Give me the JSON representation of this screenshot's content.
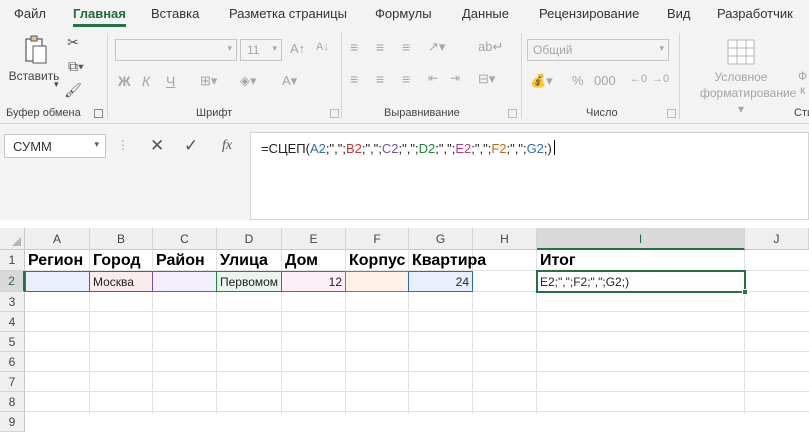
{
  "tabs": [
    "Файл",
    "Главная",
    "Вставка",
    "Разметка страницы",
    "Формулы",
    "Данные",
    "Рецензирование",
    "Вид",
    "Разработчик"
  ],
  "active_tab": "Главная",
  "ribbon": {
    "clipboard": {
      "paste": "Вставить",
      "label": "Буфер обмена"
    },
    "font": {
      "name": "",
      "size": "11",
      "bold": "Ж",
      "italic": "К",
      "underline": "Ч",
      "label": "Шрифт"
    },
    "alignment": {
      "label": "Выравнивание"
    },
    "number": {
      "format": "Общий",
      "label": "Число"
    },
    "styles": {
      "conditional_line1": "Условное",
      "conditional_line2": "форматирование",
      "label": "Сти"
    }
  },
  "formula_bar": {
    "name_box": "СУММ",
    "fx": "fx",
    "formula_parts": [
      "=СЦЕП(",
      "A2",
      ";\",\";",
      "B2",
      ";\",\";",
      "C2",
      ";\",\";",
      "D2",
      ";\",\";",
      "E2",
      ";\",\";",
      "F2",
      ";\",\";",
      "G2",
      ";)"
    ]
  },
  "grid": {
    "columns": [
      "A",
      "B",
      "C",
      "D",
      "E",
      "F",
      "G",
      "H",
      "I",
      "J"
    ],
    "rows": [
      "1",
      "2",
      "3",
      "4",
      "5",
      "6",
      "7",
      "8",
      "9"
    ],
    "row1": {
      "A": "Регион",
      "B": "Город",
      "C": "Район",
      "D": "Улица",
      "E": "Дом",
      "F": "Корпус",
      "G": "Квартира",
      "I": "Итог"
    },
    "row2": {
      "B": "Москва",
      "D": "Первомом",
      "E": "12",
      "G": "24",
      "I": "E2;\",\";F2;\",\";G2;)"
    }
  },
  "colors": {
    "accent": "#217346",
    "ref_A": "#2a6ebb",
    "ref_B": "#c0392b",
    "ref_C": "#7a4fb0",
    "ref_D": "#1e8a3a",
    "ref_E": "#b03a8a",
    "ref_F": "#c36a12",
    "ref_G": "#2a6ebb"
  }
}
